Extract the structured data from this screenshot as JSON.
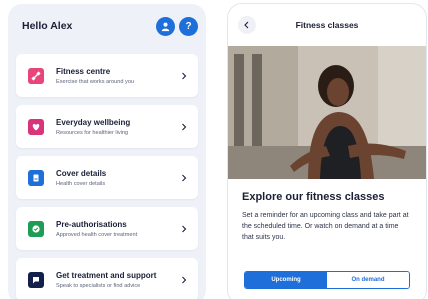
{
  "left": {
    "greeting": "Hello Alex",
    "help_label": "?",
    "cards": [
      {
        "title": "Fitness centre",
        "subtitle": "Exercise that works around you",
        "icon": "dumbbell-icon",
        "color": "#e8457a"
      },
      {
        "title": "Everyday wellbeing",
        "subtitle": "Resources for healthier living",
        "icon": "heart-icon",
        "color": "#d9347a"
      },
      {
        "title": "Cover details",
        "subtitle": "Health cover details",
        "icon": "document-icon",
        "color": "#1e6fd9"
      },
      {
        "title": "Pre-authorisations",
        "subtitle": "Approved health cover treatment",
        "icon": "check-icon",
        "color": "#1f9d55"
      },
      {
        "title": "Get treatment and support",
        "subtitle": "Speak to specialists or find advice",
        "icon": "chat-icon",
        "color": "#13204a"
      }
    ]
  },
  "right": {
    "title": "Fitness classes",
    "heading": "Explore our fitness classes",
    "body": "Set a reminder for an upcoming class and take part at the scheduled time. Or watch on demand at a time that suits you.",
    "tabs": [
      {
        "label": "Upcoming",
        "active": true
      },
      {
        "label": "On demand",
        "active": false
      }
    ]
  },
  "colors": {
    "accent": "#1e6fd9",
    "background": "#eef2f8"
  }
}
